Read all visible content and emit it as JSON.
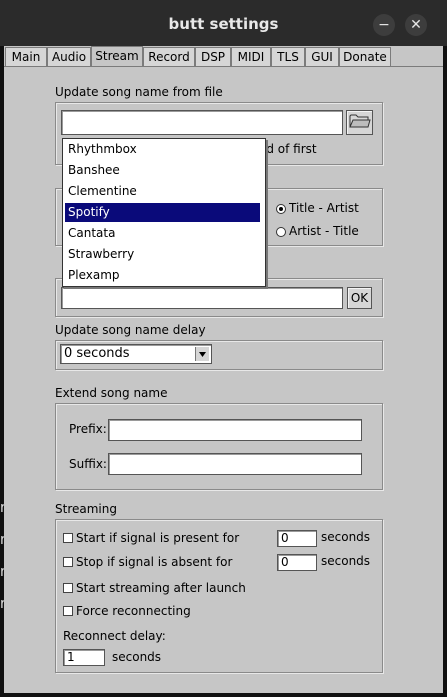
{
  "window": {
    "title": "butt settings",
    "minimize_icon": "−",
    "close_icon": "✕"
  },
  "tabs": [
    "Main",
    "Audio",
    "Stream",
    "Record",
    "DSP",
    "MIDI",
    "TLS",
    "GUI",
    "Donate"
  ],
  "active_tab": "Stream",
  "update_from_file": {
    "label": "Update song name from file",
    "path_value": "",
    "partial_text": "ad of first"
  },
  "order": {
    "title_artist": "Title - Artist",
    "artist_title": "Artist - Title",
    "selected": "Title - Artist"
  },
  "update_from_url": {
    "ok_label": "OK",
    "value": ""
  },
  "app_dropdown": {
    "items": [
      "Rhythmbox",
      "Banshee",
      "Clementine",
      "Spotify",
      "Cantata",
      "Strawberry",
      "Plexamp"
    ],
    "selected": "Spotify"
  },
  "delay": {
    "label": "Update song name delay",
    "value": "0 seconds"
  },
  "extend": {
    "label": "Extend song name",
    "prefix_label": "Prefix:",
    "prefix_value": "",
    "suffix_label": "Suffix:",
    "suffix_value": ""
  },
  "streaming": {
    "label": "Streaming",
    "start_if_present": "Start if signal is present for",
    "start_value": "0",
    "stop_if_absent": "Stop if signal is absent for",
    "stop_value": "0",
    "seconds": "seconds",
    "start_after_launch": "Start streaming after launch",
    "force_reconnect": "Force reconnecting",
    "reconnect_label": "Reconnect delay:",
    "reconnect_value": "1"
  }
}
